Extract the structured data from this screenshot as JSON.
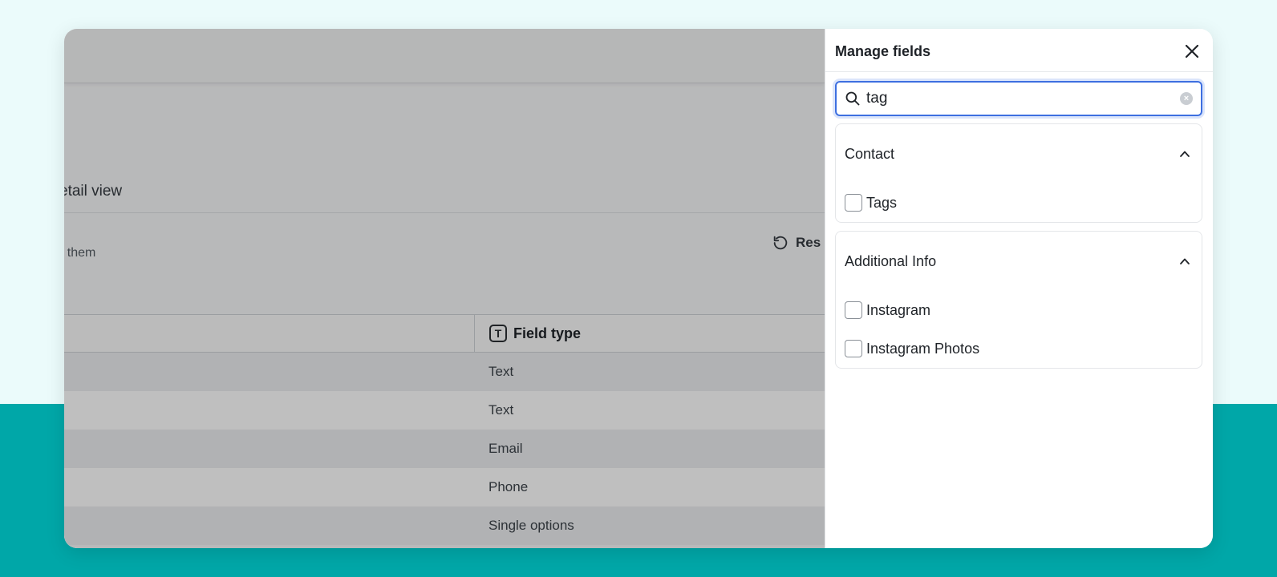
{
  "background_app": {
    "title_fragment": "etail view",
    "subtitle_fragment": "· them",
    "reset_label": "Res",
    "table": {
      "field_type_header": "Field type",
      "field_type_icon": "T",
      "rows": [
        "Text",
        "Text",
        "Email",
        "Phone",
        "Single options"
      ]
    }
  },
  "panel": {
    "title": "Manage fields",
    "search": {
      "value": "tag",
      "placeholder": ""
    },
    "groups": [
      {
        "title": "Contact",
        "options": [
          {
            "label": "Tags",
            "checked": false
          }
        ]
      },
      {
        "title": "Additional Info",
        "options": [
          {
            "label": "Instagram",
            "checked": false
          },
          {
            "label": "Instagram Photos",
            "checked": false
          }
        ]
      }
    ]
  },
  "colors": {
    "accent": "#3d6fe0",
    "teal_band": "#00a7a8",
    "page_bg": "#ebfbfb"
  }
}
